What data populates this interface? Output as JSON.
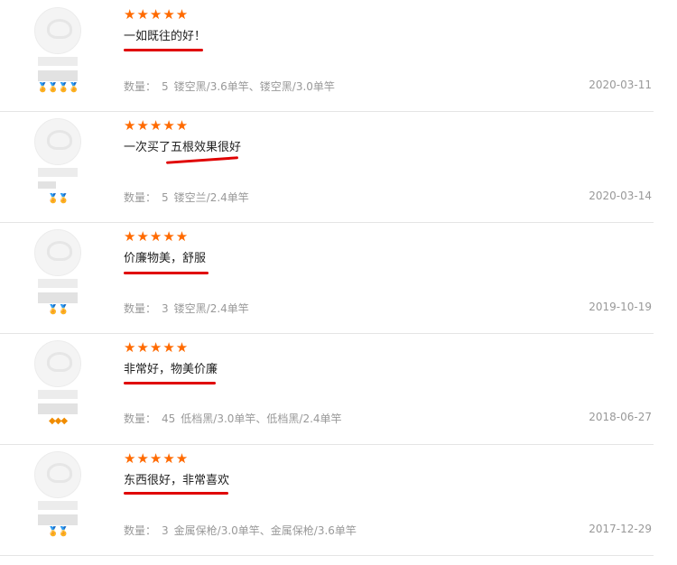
{
  "reviews": [
    {
      "stars": "★★★★★",
      "comment": "一如既往的好！",
      "qty_label": "数量：",
      "qty": "5",
      "specs": "镂空黑/3.6单竿、镂空黑/3.0单竿",
      "date": "2020-03-11",
      "medals": "🏅🏅🏅🏅"
    },
    {
      "stars": "★★★★★",
      "comment": "一次买了五根效果很好",
      "qty_label": "数量：",
      "qty": "5",
      "specs": "镂空兰/2.4单竿",
      "date": "2020-03-14",
      "medals": "🏅🏅"
    },
    {
      "stars": "★★★★★",
      "comment": "价廉物美，舒服",
      "qty_label": "数量：",
      "qty": "3",
      "specs": "镂空黑/2.4单竿",
      "date": "2019-10-19",
      "medals": "🏅🏅"
    },
    {
      "stars": "★★★★★",
      "comment": "非常好，物美价廉",
      "qty_label": "数量：",
      "qty": "45",
      "specs": "低档黑/3.0单竿、低档黑/2.4单竿",
      "date": "2018-06-27",
      "medals": "◆◆◆"
    },
    {
      "stars": "★★★★★",
      "comment": "东西很好，非常喜欢",
      "qty_label": "数量：",
      "qty": "3",
      "specs": "金属保枪/3.0单竿、金属保枪/3.6单竿",
      "date": "2017-12-29",
      "medals": "🏅🏅"
    }
  ],
  "colors": {
    "star": "#ff6a00",
    "underline": "#e00000",
    "meta": "#999999"
  }
}
